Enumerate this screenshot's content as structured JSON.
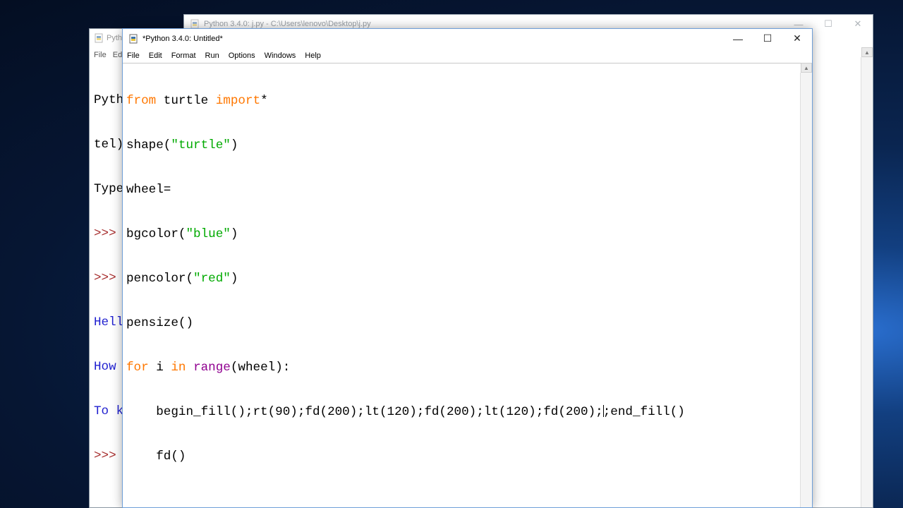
{
  "back_window": {
    "title": "Python 3.4.0: j.py - C:\\Users\\lenovo\\Desktop\\j.py",
    "minimize_glyph": "—",
    "maximize_glyph": "☐",
    "close_glyph": "✕",
    "icon": "python-file-icon"
  },
  "shell_window": {
    "title": "Pyth",
    "menu": [
      "File",
      "Ed"
    ],
    "lines": [
      {
        "text": "Pyth",
        "style": "black"
      },
      {
        "text": "tel)",
        "style": "black"
      },
      {
        "text": "Type",
        "style": "black"
      },
      {
        "text": ">>> ",
        "style": "prompt"
      },
      {
        "text": ">>> ",
        "style": "prompt"
      },
      {
        "text": "Hell",
        "style": "blue"
      },
      {
        "text": "How ",
        "style": "blue"
      },
      {
        "text": "To k",
        "style": "blue"
      },
      {
        "text": ">>> ",
        "style": "prompt"
      }
    ]
  },
  "editor_window": {
    "title": "*Python 3.4.0: Untitled*",
    "minimize_glyph": "—",
    "maximize_glyph": "☐",
    "close_glyph": "✕",
    "menu": [
      "File",
      "Edit",
      "Format",
      "Run",
      "Options",
      "Windows",
      "Help"
    ],
    "code": {
      "l1_kw1": "from",
      "l1_mid": " turtle ",
      "l1_kw2": "import",
      "l1_end": "*",
      "l2_a": "shape(",
      "l2_str": "\"turtle\"",
      "l2_b": ")",
      "l3": "wheel=",
      "l4_a": "bgcolor(",
      "l4_str": "\"blue\"",
      "l4_b": ")",
      "l5_a": "pencolor(",
      "l5_str": "\"red\"",
      "l5_b": ")",
      "l6": "pensize()",
      "l7_kw1": "for",
      "l7_mid": " i ",
      "l7_kw2": "in",
      "l7_sp": " ",
      "l7_bi": "range",
      "l7_end": "(wheel):",
      "l8_a": "    begin_fill();rt(90);fd(200);lt(120);fd(200);lt(120);fd(200);",
      "l8_b": ";end_fill()",
      "l9": "    fd()"
    }
  },
  "colors": {
    "keyword": "#ff7700",
    "builtin": "#900090",
    "string": "#00aa00",
    "prompt": "#a52a2a",
    "shell_output": "#1f1fcf",
    "desktop": "#0a2550"
  }
}
